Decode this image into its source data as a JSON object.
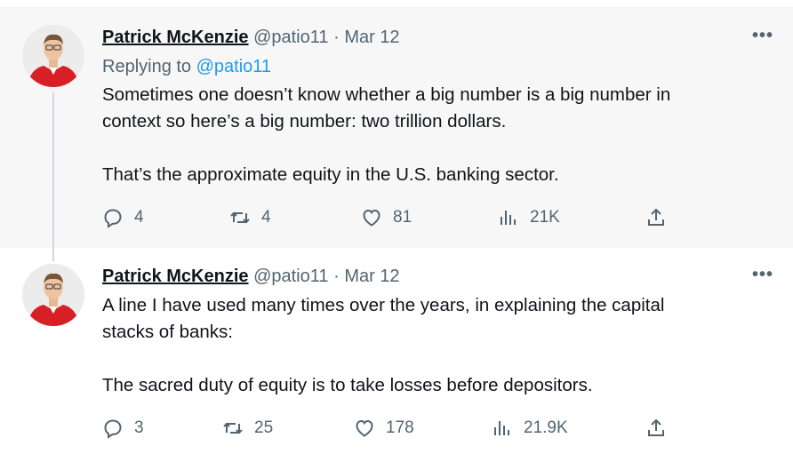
{
  "colors": {
    "link": "#1d9bf0",
    "muted": "#536471",
    "text": "#0f1419",
    "thread_bg": "#f7f7f7"
  },
  "tweets": [
    {
      "author": "Patrick McKenzie",
      "handle": "@patio11",
      "separator": "·",
      "date": "Mar 12",
      "reply_prefix": "Replying to",
      "reply_to": "@patio11",
      "lines": [
        "Sometimes one doesn’t know whether a big number is a big number in",
        "context so here’s a big number: two trillion dollars.",
        "That’s the approximate equity in the U.S. banking sector."
      ],
      "replies": "4",
      "retweets": "4",
      "likes": "81",
      "views": "21K",
      "more": "•••",
      "icons": {
        "more": "more-icon",
        "reply": "reply-icon",
        "retweet": "retweet-icon",
        "like": "like-icon",
        "views": "views-icon",
        "share": "share-icon"
      }
    },
    {
      "author": "Patrick McKenzie",
      "handle": "@patio11",
      "separator": "·",
      "date": "Mar 12",
      "lines": [
        "A line I have used many times over the years, in explaining the capital",
        "stacks of banks:",
        "The sacred duty of equity is to take losses before depositors."
      ],
      "replies": "3",
      "retweets": "25",
      "likes": "178",
      "views": "21.9K",
      "more": "•••",
      "icons": {
        "more": "more-icon",
        "reply": "reply-icon",
        "retweet": "retweet-icon",
        "like": "like-icon",
        "views": "views-icon",
        "share": "share-icon"
      }
    }
  ]
}
